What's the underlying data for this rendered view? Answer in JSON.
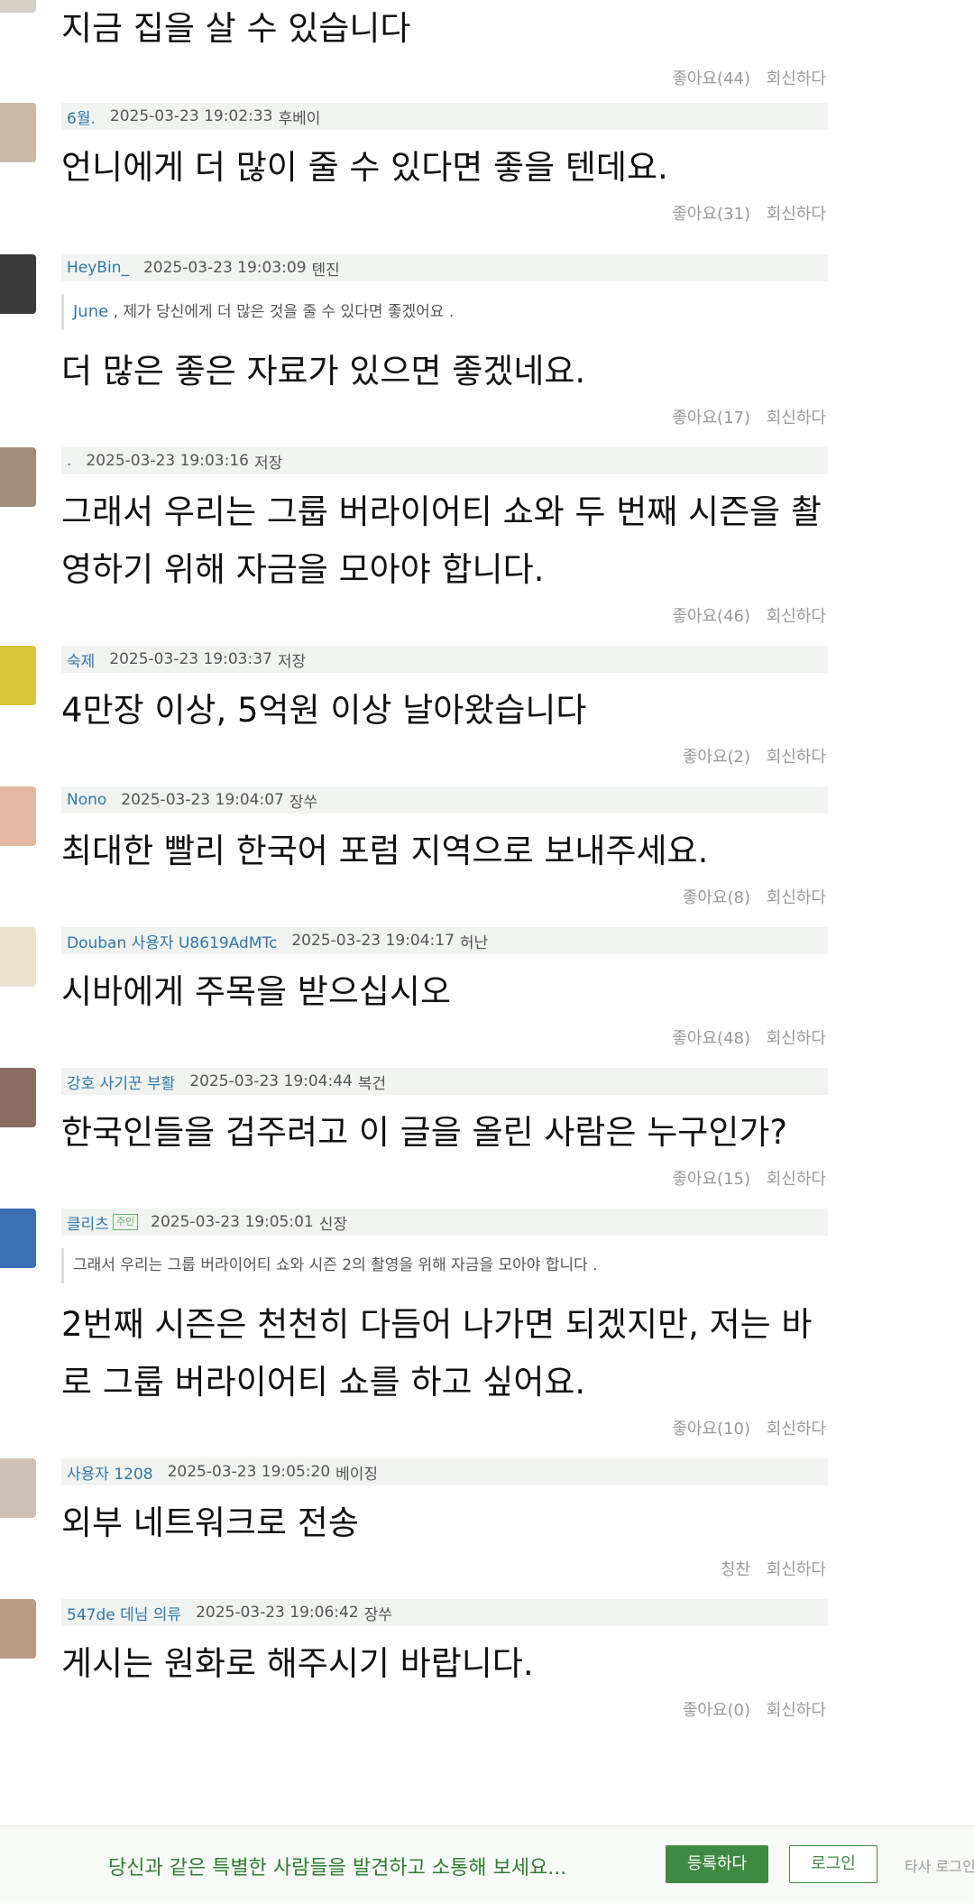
{
  "first_comment": {
    "text": "지금 집을 살 수 있습니다",
    "like": "좋아요(44)",
    "reply": "회신하다"
  },
  "comments": [
    {
      "author": "6월.",
      "time": "2025-03-23 19:02:33",
      "location": "후베이",
      "text": "언니에게 더 많이 줄 수 있다면 좋을 텐데요.",
      "like": "좋아요(31)",
      "reply": "회신하다",
      "avatar_color": "#c9b9a6"
    },
    {
      "author": "HeyBin_",
      "time": "2025-03-23 19:03:09",
      "location": "톈진",
      "quote_author": "June",
      "quote_text": " , 제가 당신에게 더 많은 것을 줄 수 있다면 좋겠어요 .",
      "text": "더 많은 좋은 자료가 있으면 좋겠네요.",
      "like": "좋아요(17)",
      "reply": "회신하다",
      "avatar_color": "#3a3a3a"
    },
    {
      "author": ".",
      "time": "2025-03-23 19:03:16",
      "location": "저장",
      "text": "그래서 우리는 그룹 버라이어티 쇼와 두 번째 시즌을 촬영하기 위해 자금을 모아야 합니다.",
      "like": "좋아요(46)",
      "reply": "회신하다",
      "avatar_color": "#a08d7a"
    },
    {
      "author": "숙제",
      "time": "2025-03-23 19:03:37",
      "location": "저장",
      "text": "4만장 이상, 5억원 이상 날아왔습니다",
      "like": "좋아요(2)",
      "reply": "회신하다",
      "avatar_color": "#d8c63a"
    },
    {
      "author": "Nono",
      "time": "2025-03-23 19:04:07",
      "location": "장쑤",
      "text": "최대한 빨리 한국어 포럼 지역으로 보내주세요.",
      "like": "좋아요(8)",
      "reply": "회신하다",
      "avatar_color": "#e3b7a3"
    },
    {
      "author": "Douban 사용자 U8619AdMTc",
      "time": "2025-03-23 19:04:17",
      "location": "허난",
      "text": "시바에게 주목을 받으십시오",
      "like": "좋아요(48)",
      "reply": "회신하다",
      "avatar_color": "#e8e2cf"
    },
    {
      "author": "강호 사기꾼 부활",
      "time": "2025-03-23 19:04:44",
      "location": "복건",
      "text": "한국인들을 겁주려고 이 글을 올린 사람은 누구인가?",
      "like": "좋아요(15)",
      "reply": "회신하다",
      "avatar_color": "#8a6c63"
    },
    {
      "author": "클리츠",
      "badge": "주인",
      "time": "2025-03-23 19:05:01",
      "location": "신장",
      "quote_text": "그래서 우리는 그룹 버라이어티 쇼와 시즌 2의 촬영을 위해 자금을 모아야 합니다 .",
      "text": "2번째 시즌은 천천히 다듬어 나가면 되겠지만, 저는 바로 그룹 버라이어티 쇼를 하고 싶어요.",
      "like": "좋아요(10)",
      "reply": "회신하다",
      "avatar_color": "#3c6fb5"
    },
    {
      "author": "사용자 1208",
      "time": "2025-03-23 19:05:20",
      "location": "베이징",
      "text": "외부 네트워크로 전송",
      "like": "칭찬",
      "reply": "회신하다",
      "avatar_color": "#cfc1b5"
    },
    {
      "author": "547de 데님 의류",
      "time": "2025-03-23 19:06:42",
      "location": "장쑤",
      "text": "게시는 원화로 해주시기 바랍니다.",
      "like": "좋아요(0)",
      "reply": "회신하다",
      "avatar_color": "#b99a85"
    }
  ],
  "bottom_bar": {
    "promo": "당신과 같은 특별한 사람들을 발견하고 소통해 보세요...",
    "register": "등록하다",
    "login": "로그인",
    "other_login": "타사 로그인"
  },
  "colors": {
    "author": "#3377aa",
    "meta_bg": "#f0f3f0",
    "brand_green": "#3d8b40"
  }
}
